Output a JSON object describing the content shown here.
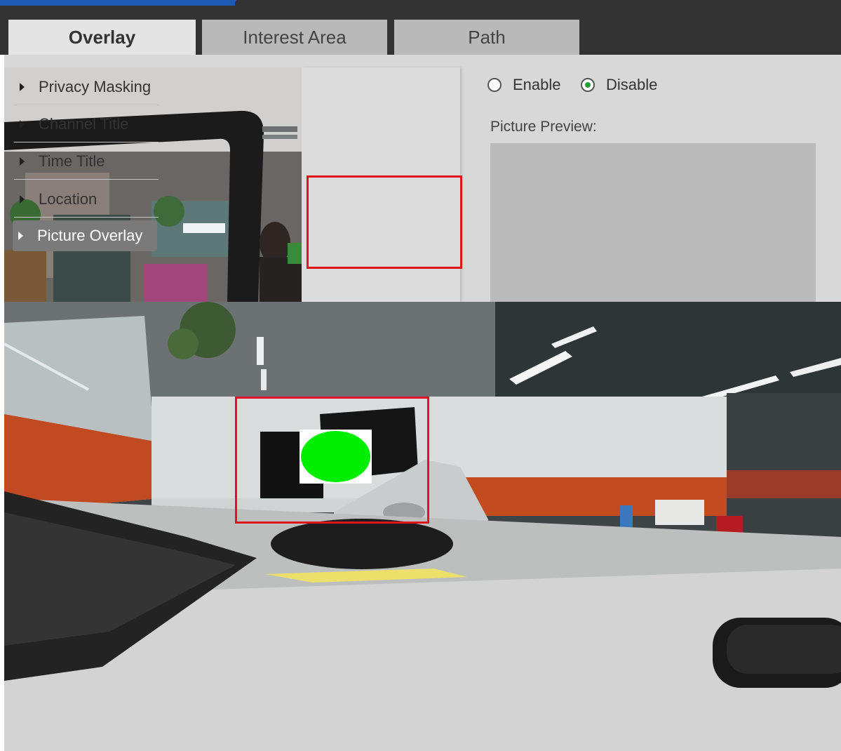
{
  "tabs": [
    {
      "label": "Overlay",
      "active": true
    },
    {
      "label": "Interest Area",
      "active": false
    },
    {
      "label": "Path",
      "active": false
    }
  ],
  "submenu": {
    "items": [
      {
        "label": "Privacy Masking"
      },
      {
        "label": "Channel Title"
      },
      {
        "label": "Time Title"
      },
      {
        "label": "Location"
      },
      {
        "label": "Picture Overlay",
        "selected": true
      }
    ]
  },
  "settings": {
    "enable_label": "Enable",
    "disable_label": "Disable",
    "selected": "Disable",
    "preview_label": "Picture Preview:"
  },
  "colors": {
    "highlight": "#e0141b",
    "overlay_marker": "#00ee00",
    "brand": "#1f5bb5"
  }
}
